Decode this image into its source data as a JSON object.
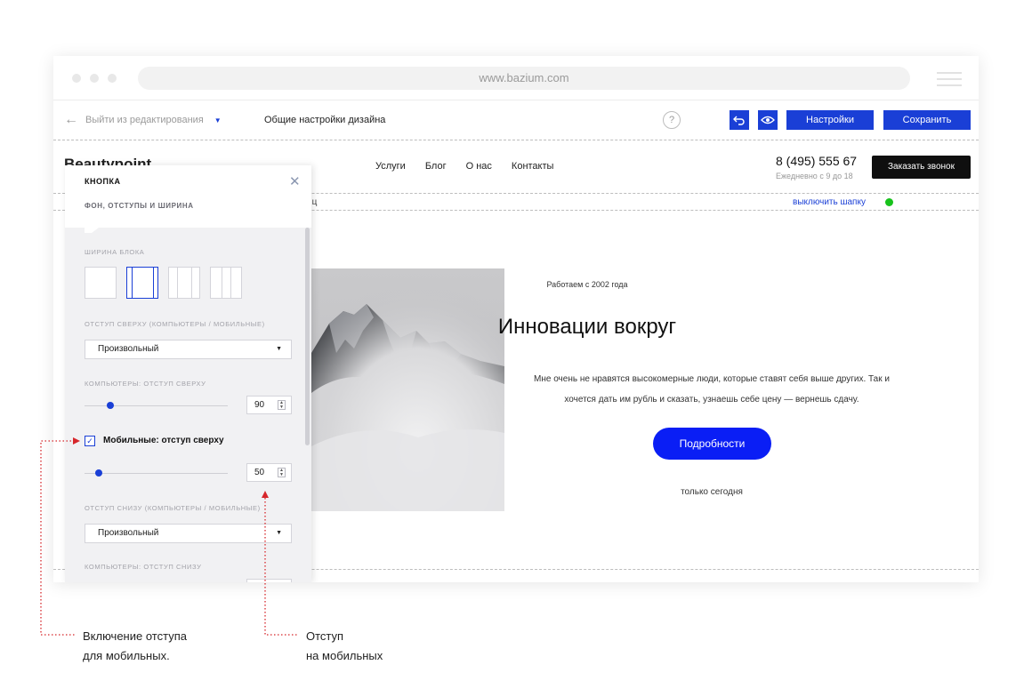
{
  "browser": {
    "url": "www.bazium.com"
  },
  "toolbar": {
    "back_label": "Выйти из редактирования",
    "section_title": "Общие настройки дизайна",
    "help_label": "?",
    "settings_label": "Настройки",
    "save_label": "Сохранить"
  },
  "site": {
    "logo": "Beautypoint",
    "nav": [
      "Услуги",
      "Блог",
      "О нас",
      "Контакты"
    ],
    "phone": "8 (495) 555 67",
    "hours": "Ежедневно с 9 до 18",
    "call_button": "Заказать звонок",
    "strip_text": "иц",
    "hide_header": "выключить шапку",
    "hero": {
      "tagline": "Работаем с 2002 года",
      "headline": "Инновации вокруг",
      "paragraph": "Мне очень не нравятся высокомерные люди, которые ставят себя выше других. Так и хочется дать им рубль и сказать, узнаешь себе цену — вернешь сдачу.",
      "cta": "Подробности",
      "note": "только сегодня"
    }
  },
  "panel": {
    "title": "КНОПКА",
    "subtitle": "ФОН, ОТСТУПЫ И ШИРИНА",
    "width_label": "ШИРИНА БЛОКА",
    "top_label": "ОТСТУП СВЕРХУ (КОМПЬЮТЕРЫ / МОБИЛЬНЫЕ)",
    "top_select": "Произвольный",
    "desktop_top_label": "КОМПЬЮТЕРЫ: ОТСТУП СВЕРХУ",
    "desktop_top_value": "90",
    "mobile_checkbox_label": "Мобильные: отступ сверху",
    "mobile_top_value": "50",
    "bottom_label": "ОТСТУП СНИЗУ (КОМПЬЮТЕРЫ / МОБИЛЬНЫЕ)",
    "bottom_select": "Произвольный",
    "desktop_bottom_label": "КОМПЬЮТЕРЫ: ОТСТУП СНИЗУ"
  },
  "annotations": {
    "mobile_enable_line1": "Включение отступа",
    "mobile_enable_line2": "для мобильных.",
    "mobile_offset_line1": "Отступ",
    "mobile_offset_line2": "на мобильных"
  },
  "colors": {
    "accent": "#1a3fd6",
    "cta": "#0a1ef5",
    "status": "#17c21b",
    "annotation": "#d6262b"
  }
}
